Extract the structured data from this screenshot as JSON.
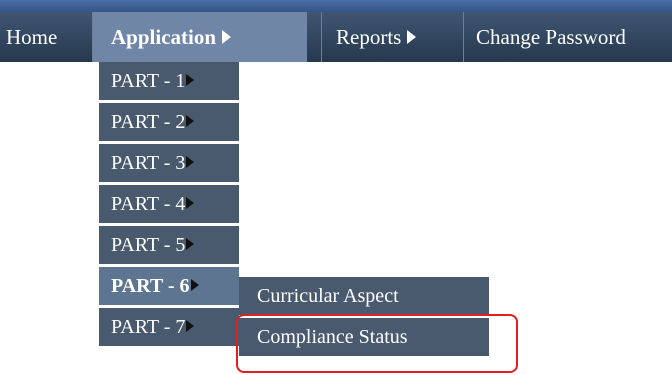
{
  "menubar": {
    "home_label": "Home",
    "application_label": "Application",
    "reports_label": "Reports",
    "change_password_label": "Change Password"
  },
  "application_menu": {
    "items": [
      {
        "label": "PART - 1"
      },
      {
        "label": "PART - 2"
      },
      {
        "label": "PART - 3"
      },
      {
        "label": "PART - 4"
      },
      {
        "label": "PART - 5"
      },
      {
        "label": "PART - 6"
      },
      {
        "label": "PART - 7"
      }
    ],
    "active_item": "PART - 6"
  },
  "part6_submenu": {
    "items": [
      {
        "label": "Curricular Aspect"
      },
      {
        "label": "Compliance Status"
      }
    ]
  },
  "annotation": {
    "highlight_color": "#e02020"
  },
  "colors": {
    "menubar": "#2f4259",
    "active_menu": "#6f86a6",
    "dropdown": "#495a6f"
  }
}
